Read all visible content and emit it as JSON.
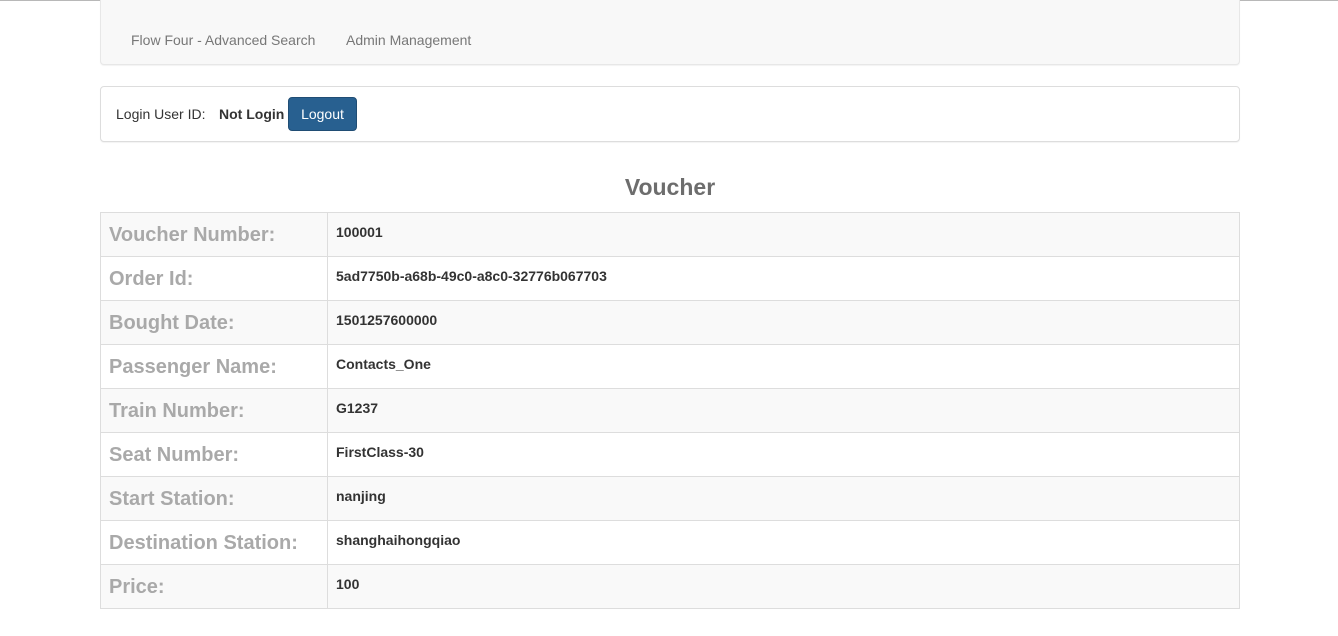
{
  "nav": {
    "items": [
      {
        "label": "Flow Four - Advanced Search"
      },
      {
        "label": "Admin Management"
      }
    ]
  },
  "login": {
    "label": "Login User ID:",
    "value": "Not Login",
    "logout_label": "Logout"
  },
  "voucher": {
    "title": "Voucher",
    "rows": [
      {
        "label": "Voucher Number:",
        "value": "100001"
      },
      {
        "label": "Order Id:",
        "value": "5ad7750b-a68b-49c0-a8c0-32776b067703"
      },
      {
        "label": "Bought Date:",
        "value": "1501257600000"
      },
      {
        "label": "Passenger Name:",
        "value": "Contacts_One"
      },
      {
        "label": "Train Number:",
        "value": "G1237"
      },
      {
        "label": "Seat Number:",
        "value": "FirstClass-30"
      },
      {
        "label": "Start Station:",
        "value": "nanjing"
      },
      {
        "label": "Destination Station:",
        "value": "shanghaihongqiao"
      },
      {
        "label": "Price:",
        "value": "100"
      }
    ]
  },
  "colors": {
    "primary_button": "#286090",
    "label_text": "#a9a9a9",
    "title_text": "#6d6d6d"
  }
}
